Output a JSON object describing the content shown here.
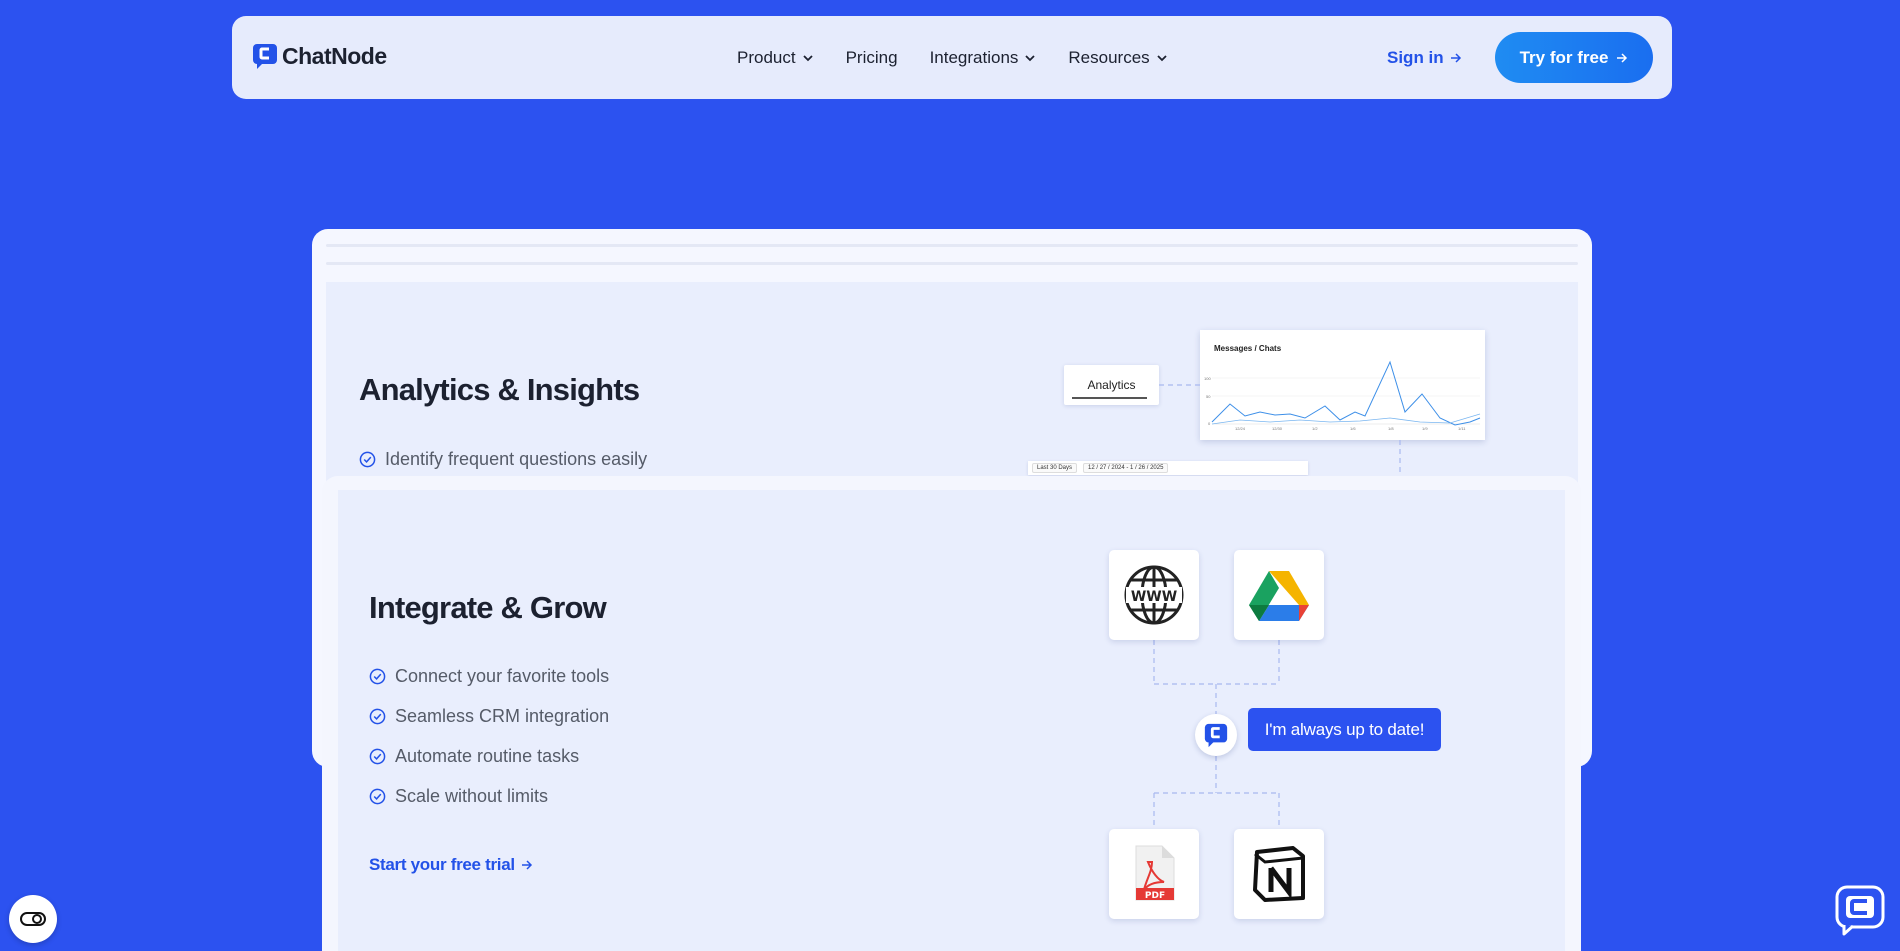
{
  "nav": {
    "brand": "ChatNode",
    "items": [
      {
        "label": "Product",
        "dropdown": true
      },
      {
        "label": "Pricing",
        "dropdown": false
      },
      {
        "label": "Integrations",
        "dropdown": true
      },
      {
        "label": "Resources",
        "dropdown": true
      }
    ],
    "sign_in": "Sign in",
    "cta": "Try for free"
  },
  "analytics": {
    "title": "Analytics & Insights",
    "features": [
      "Identify frequent questions easily"
    ],
    "tab_label": "Analytics",
    "chart": {
      "title": "Messages / Chats",
      "yticks": [
        "100",
        "50",
        "0"
      ],
      "xticks": [
        "12/24",
        "12/30",
        "1/2",
        "1/6",
        "1/8",
        "1/9",
        "1/11"
      ]
    },
    "date_filter": {
      "range": "Last 30 Days",
      "dates": "12 / 27 / 2024  -  1 / 26 / 2025"
    }
  },
  "integrate": {
    "title": "Integrate & Grow",
    "features": [
      "Connect your favorite tools",
      "Seamless CRM integration",
      "Automate routine tasks",
      "Scale without limits"
    ],
    "cta": "Start your free trial",
    "bubble": "I'm always up to date!",
    "sources": [
      "www-icon",
      "google-drive-icon",
      "pdf-icon",
      "notion-icon"
    ]
  },
  "colors": {
    "background": "#2c52f0",
    "accent": "#2352e8",
    "card": "#e9eefd"
  }
}
